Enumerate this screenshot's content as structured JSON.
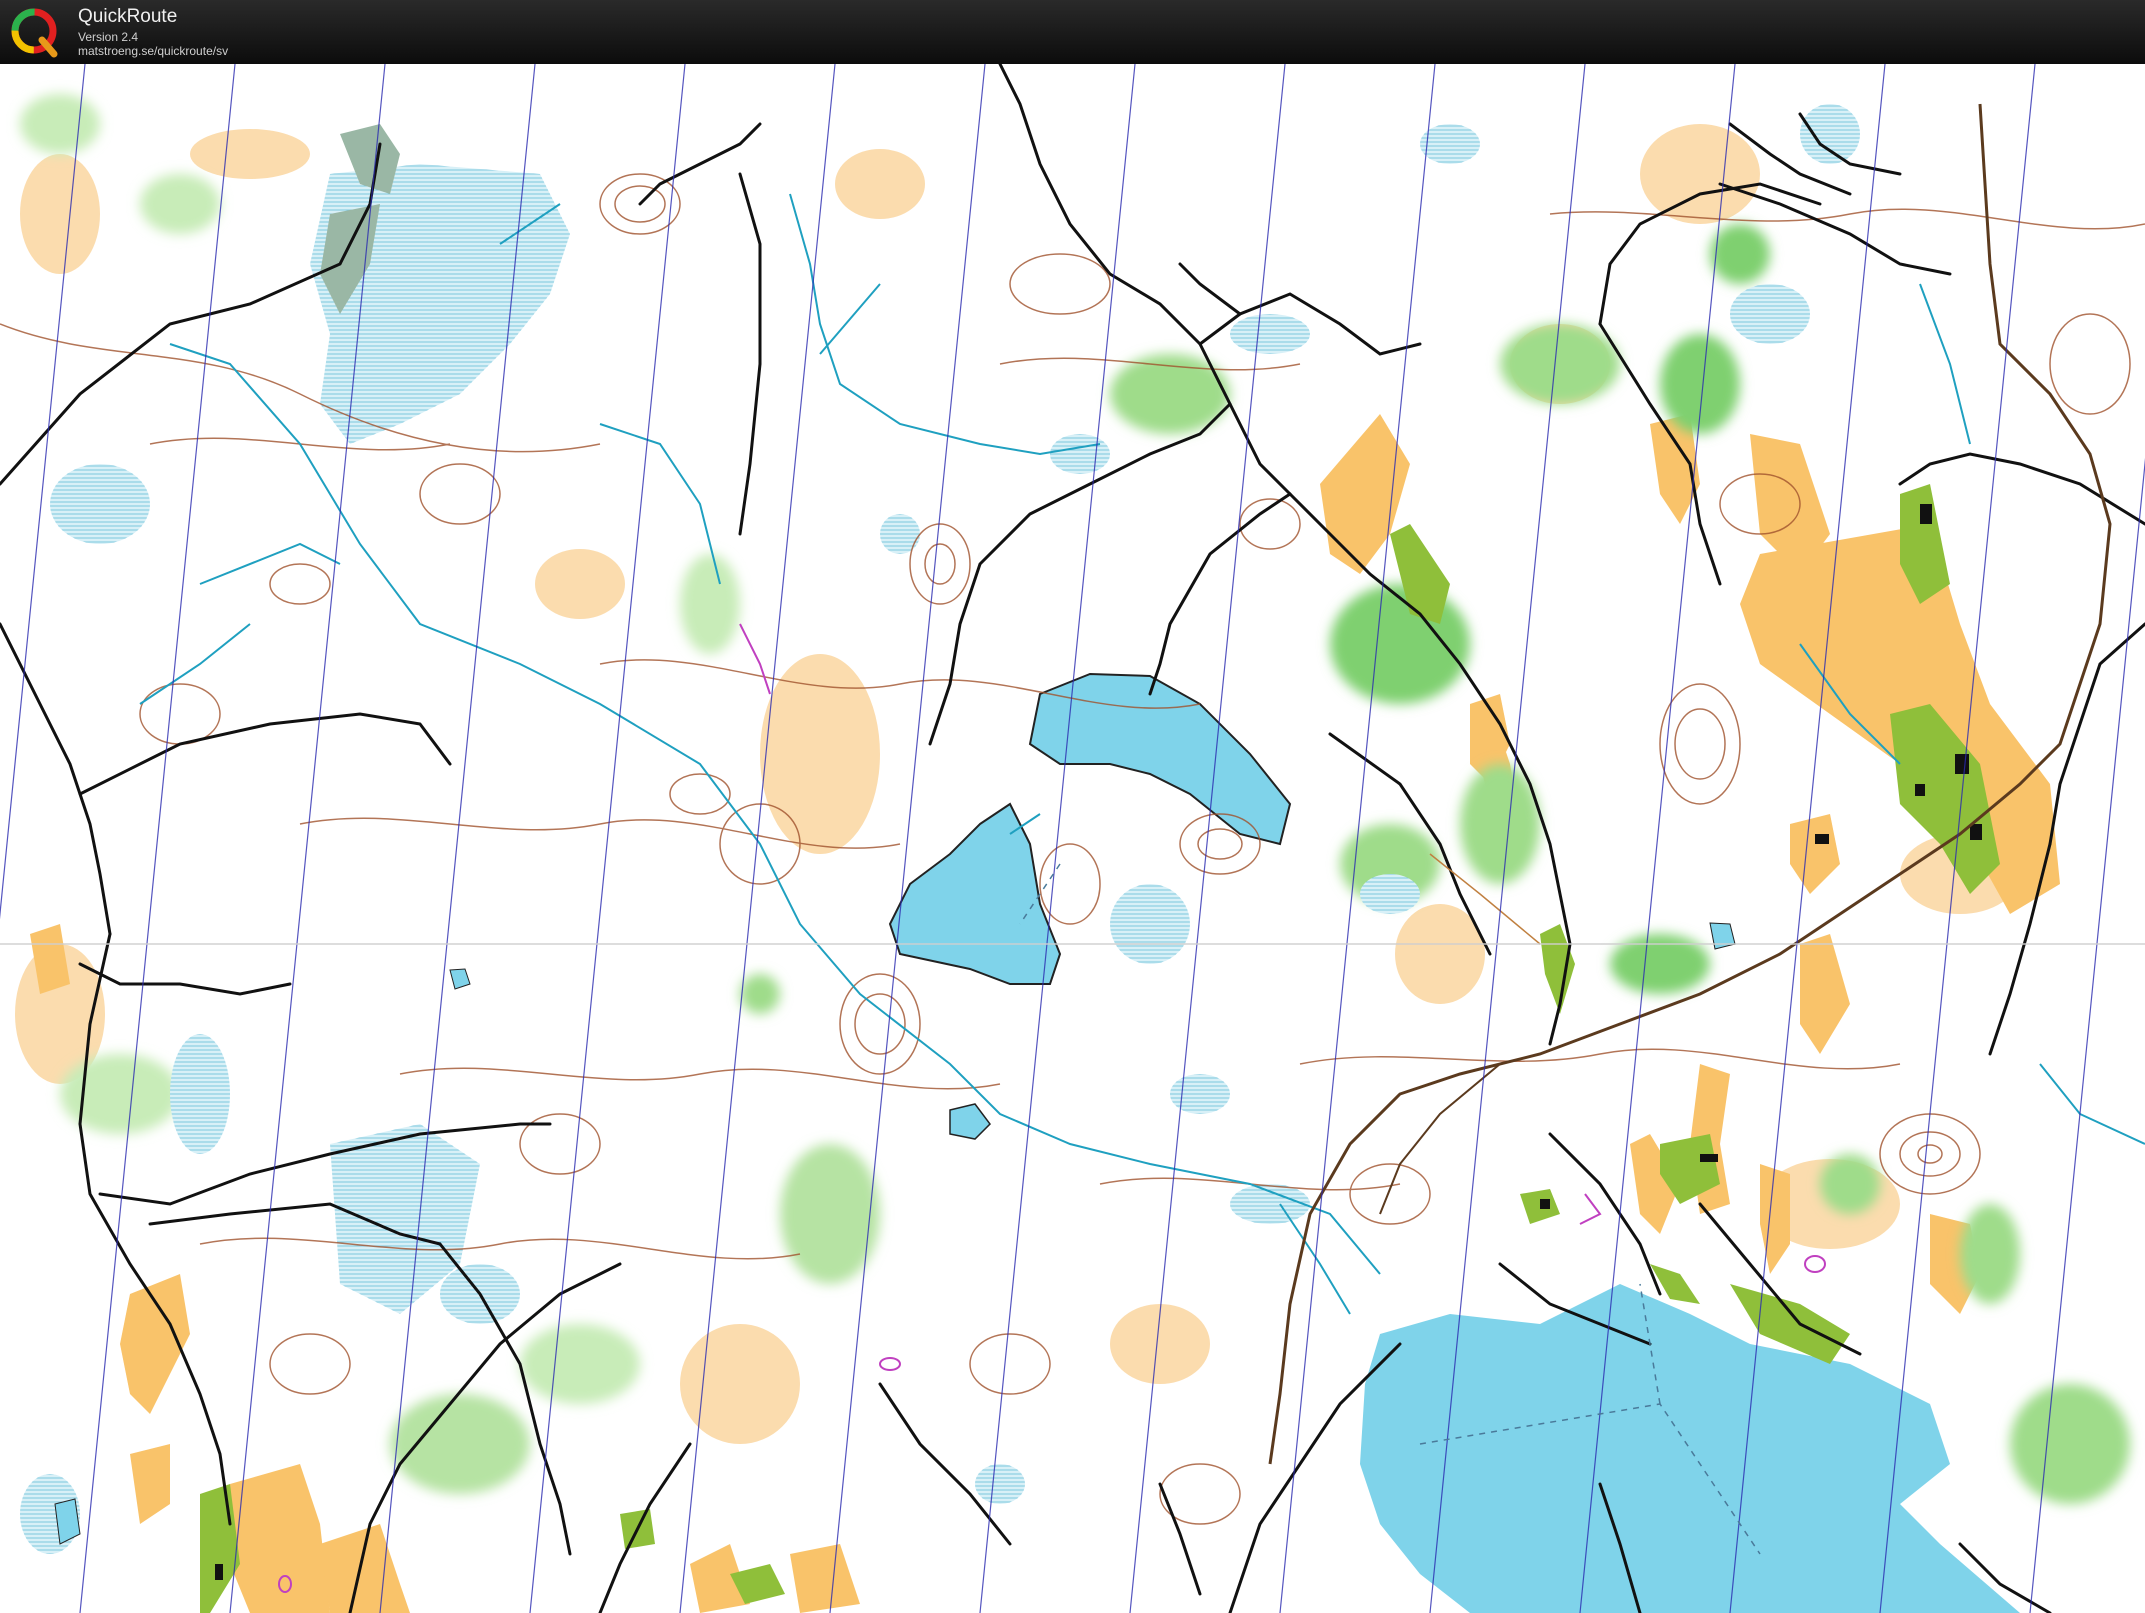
{
  "app": {
    "title": "QuickRoute",
    "version": "Version 2.4",
    "url": "matstroeng.se/quickroute/sv"
  },
  "icons": {
    "logo": "quickroute-q-logo"
  },
  "colors": {
    "header_bg": "#111111",
    "water": "#7fd3ea",
    "marsh": "#9fd6e6",
    "open_land": "#f9c36a",
    "rough_open": "#fbdcae",
    "green_light": "#c8ecb8",
    "green_dark": "#3fae45",
    "cultivated": "#8fbf3a",
    "contour": "#a0522d",
    "path": "#111111",
    "magnetic_north_line": "#2a2ab0",
    "stream": "#1fa0c0",
    "railway": "#5b3a1e"
  },
  "map": {
    "layers": [
      "open-land",
      "marsh",
      "vegetation",
      "water",
      "contours",
      "streams",
      "paths",
      "railway",
      "north-lines",
      "buildings"
    ]
  }
}
